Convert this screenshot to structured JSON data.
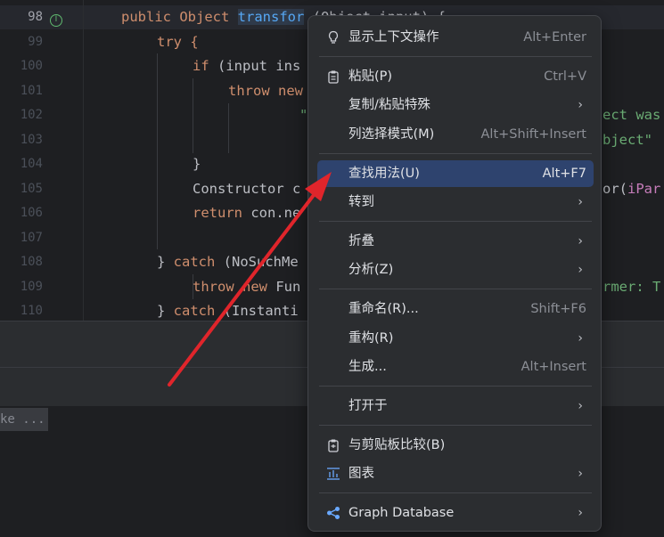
{
  "editor": {
    "lines": [
      {
        "num": "98",
        "current": true
      },
      {
        "num": "99"
      },
      {
        "num": "100"
      },
      {
        "num": "101"
      },
      {
        "num": "102"
      },
      {
        "num": "103"
      },
      {
        "num": "104"
      },
      {
        "num": "105"
      },
      {
        "num": "106"
      },
      {
        "num": "107"
      },
      {
        "num": "108"
      },
      {
        "num": "109"
      },
      {
        "num": "110"
      }
    ],
    "code": {
      "l98_a": "public Object ",
      "l98_fn": "transfor",
      "l98_b": " (Object input) {",
      "l99": "try {",
      "l100_kw": "if",
      "l100_b": " (input ins",
      "l101_kw": "throw new",
      "l102_str": "\"",
      "l102_right": "ect was",
      "l103_str": "\"",
      "l103_right": "bject\"",
      "l104": "}",
      "l105_a": "Constructor c",
      "l105_right_a": "or(",
      "l105_right_p": "iPar",
      "l106_kw": "return",
      "l106_b": " con.ne",
      "l108_a": "} ",
      "l108_kw": "catch",
      "l108_b": " (NoSuchMe",
      "l109_kw": "throw new",
      "l109_b": " Fun",
      "l109_right": "rmer: T",
      "l110_a": "} ",
      "l110_kw": "catch",
      "l110_b": " (Instanti"
    },
    "impl_icon": "implements-icon"
  },
  "bottom_hint": "ke ...",
  "menu": {
    "items": [
      {
        "label": "显示上下文操作",
        "shortcut": "Alt+Enter",
        "icon": "lightbulb-icon"
      },
      {
        "label": "粘贴(P)",
        "shortcut": "Ctrl+V",
        "icon": "clipboard-icon"
      },
      {
        "label": "复制/粘贴特殊",
        "shortcut": "",
        "submenu": true
      },
      {
        "label": "列选择模式(M)",
        "shortcut": "Alt+Shift+Insert"
      },
      {
        "label": "查找用法(U)",
        "shortcut": "Alt+F7",
        "selected": true
      },
      {
        "label": "转到",
        "submenu": true
      },
      {
        "label": "折叠",
        "submenu": true
      },
      {
        "label": "分析(Z)",
        "submenu": true
      },
      {
        "label": "重命名(R)...",
        "shortcut": "Shift+F6"
      },
      {
        "label": "重构(R)",
        "submenu": true
      },
      {
        "label": "生成...",
        "shortcut": "Alt+Insert"
      },
      {
        "label": "打开于",
        "submenu": true
      },
      {
        "label": "与剪贴板比较(B)",
        "icon": "compare-clipboard-icon"
      },
      {
        "label": "图表",
        "submenu": true,
        "icon": "diagram-icon"
      },
      {
        "label": "Graph Database",
        "submenu": true,
        "icon": "share-graph-icon"
      }
    ],
    "submenu_glyph": "›"
  },
  "colors": {
    "selection": "#2e436e",
    "annotation_arrow": "#e0252b"
  }
}
